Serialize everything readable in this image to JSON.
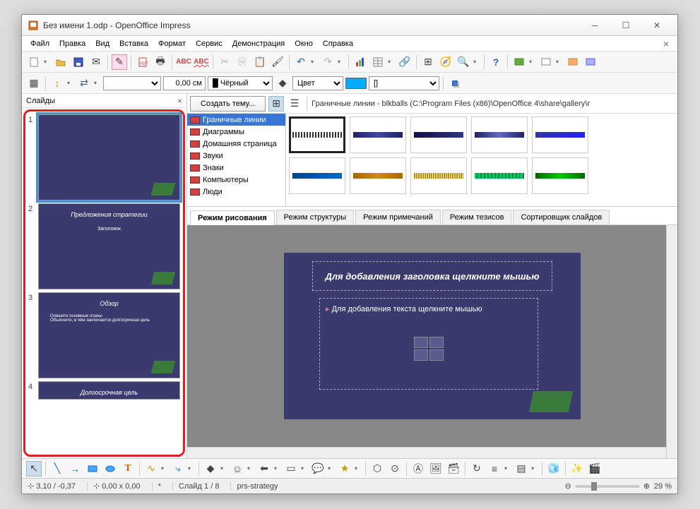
{
  "window": {
    "title": "Без имени 1.odp - OpenOffice Impress"
  },
  "menu": {
    "file": "Файл",
    "edit": "Правка",
    "view": "Вид",
    "insert": "Вставка",
    "format": "Формат",
    "tools": "Сервис",
    "slideshow": "Демонстрация",
    "window": "Окно",
    "help": "Справка"
  },
  "toolbar2": {
    "width_value": "0,00 см",
    "color_label": "Чёрный",
    "fill_label": "Цвет",
    "fill_preview": "[]"
  },
  "sidebar": {
    "title": "Слайды",
    "slides": [
      {
        "num": "1",
        "title": "",
        "body": ""
      },
      {
        "num": "2",
        "title": "Предложения стратегии",
        "body": "Заголовок"
      },
      {
        "num": "3",
        "title": "Обзор",
        "bullets": [
          "Опишите основные планы",
          "Объясните, в чём заключается долгосрочная цель"
        ]
      },
      {
        "num": "4",
        "title": "Долгосрочная цель",
        "body": ""
      }
    ]
  },
  "gallery": {
    "new_theme": "Создать тему...",
    "path": "Граничные линии - blkballs (C:\\Program Files (x86)\\OpenOffice 4\\share\\gallery\\r",
    "categories": [
      "Граничные линии",
      "Диаграммы",
      "Домашняя страница",
      "Звуки",
      "Знаки",
      "Компьютеры",
      "Люди"
    ],
    "selected_category": 0
  },
  "tabs": {
    "drawing": "Режим рисования",
    "outline": "Режим структуры",
    "notes": "Режим примечаний",
    "handout": "Режим тезисов",
    "sorter": "Сортировщик слайдов"
  },
  "canvas": {
    "title_placeholder": "Для добавления заголовка щелкните мышью",
    "body_placeholder": "Для добавления текста щелкните мышью"
  },
  "status": {
    "coords": "3,10 / -0,37",
    "size": "0,00 x 0,00",
    "mod": "*",
    "slide": "Слайд 1 / 8",
    "template": "prs-strategy",
    "zoom": "29 %"
  }
}
